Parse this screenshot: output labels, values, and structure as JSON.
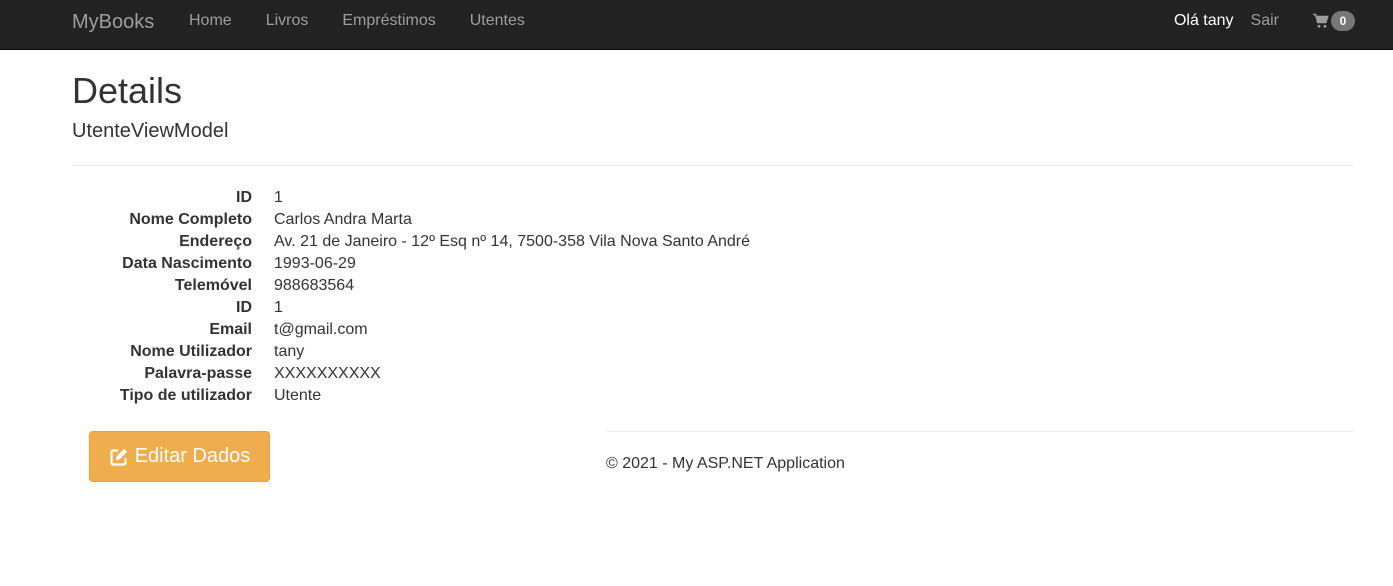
{
  "navbar": {
    "brand": "MyBooks",
    "links": [
      "Home",
      "Livros",
      "Empréstimos",
      "Utentes"
    ],
    "greeting": "Olá tany",
    "logout": "Sair",
    "cart_icon": "shopping-cart-icon",
    "cart_count": "0"
  },
  "page": {
    "title": "Details",
    "subtitle": "UtenteViewModel"
  },
  "details": [
    {
      "label": "ID",
      "value": "1"
    },
    {
      "label": "Nome Completo",
      "value": "Carlos Andra Marta"
    },
    {
      "label": "Endereço",
      "value": "Av. 21 de Janeiro - 12º Esq nº 14, 7500-358 Vila Nova Santo André"
    },
    {
      "label": "Data Nascimento",
      "value": "1993-06-29"
    },
    {
      "label": "Telemóvel",
      "value": "988683564"
    },
    {
      "label": "ID",
      "value": "1"
    },
    {
      "label": "Email",
      "value": "t@gmail.com"
    },
    {
      "label": "Nome Utilizador",
      "value": "tany"
    },
    {
      "label": "Palavra-passe",
      "value": "XXXXXXXXXX"
    },
    {
      "label": "Tipo de utilizador",
      "value": "Utente"
    }
  ],
  "actions": {
    "edit_label": "Editar Dados",
    "edit_icon": "edit-icon"
  },
  "footer": {
    "text": "© 2021 - My ASP.NET Application"
  },
  "colors": {
    "navbar_bg": "#222222",
    "button_warning": "#f0ad4e",
    "badge_bg": "#777777"
  }
}
